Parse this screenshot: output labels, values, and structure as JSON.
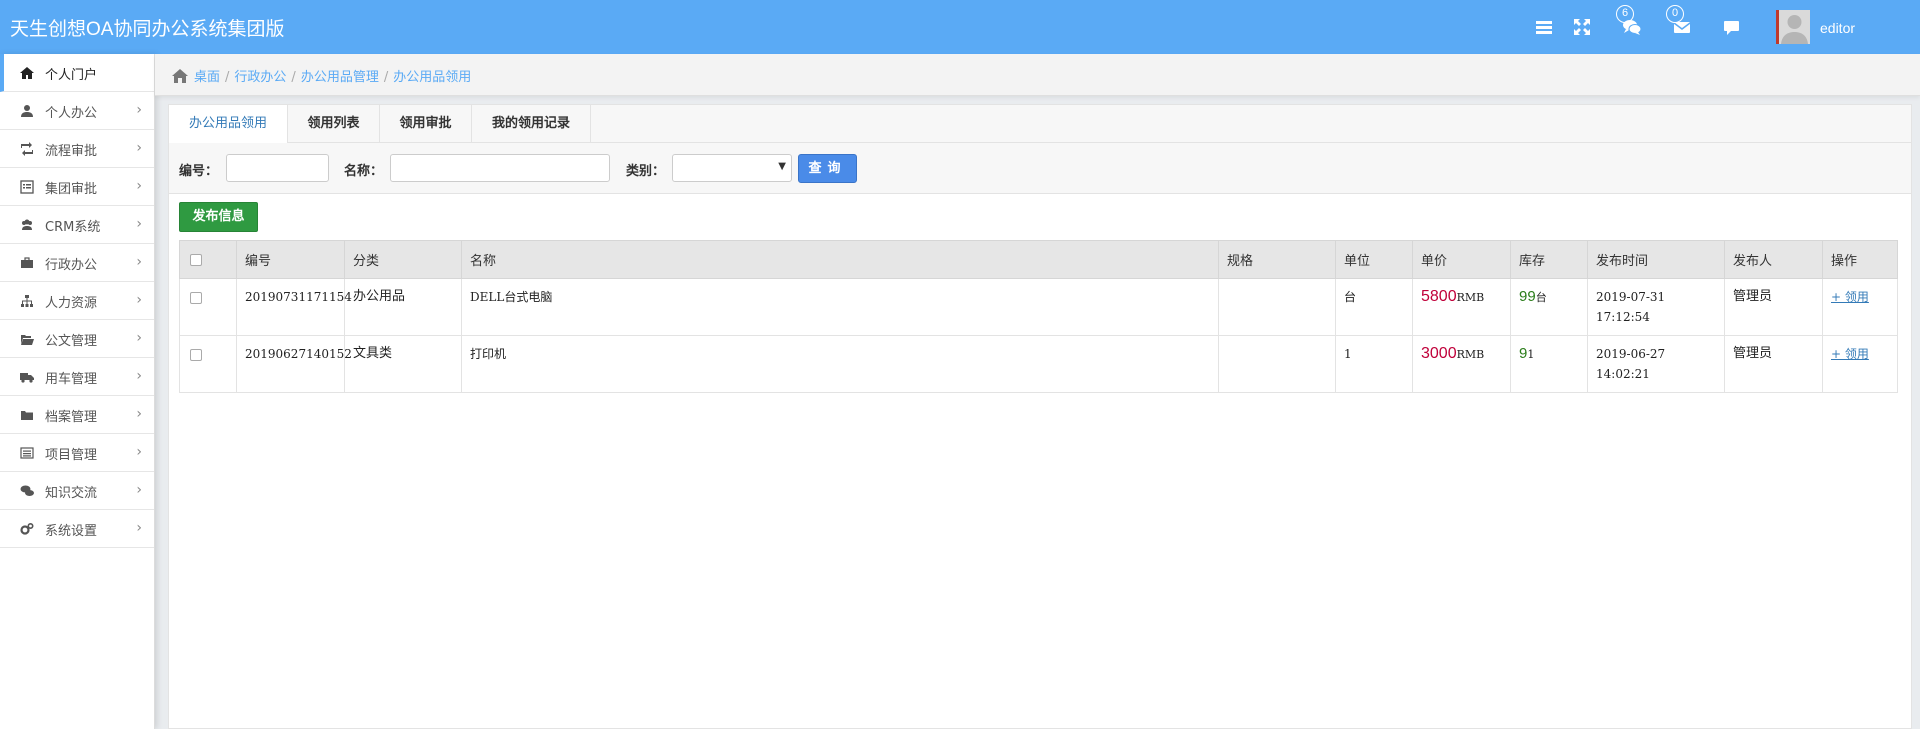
{
  "app": {
    "title": "天生创想OA协同办公系统集团版"
  },
  "header": {
    "chat_badge": "6",
    "mail_badge": "0",
    "username": "editor",
    "icons": [
      "menu-icon",
      "fullscreen-icon",
      "chat-icon",
      "mail-icon",
      "message-icon"
    ]
  },
  "sidebar": {
    "items": [
      {
        "label": "个人门户",
        "icon": "home-icon",
        "active": true
      },
      {
        "label": "个人办公",
        "icon": "user-icon"
      },
      {
        "label": "流程审批",
        "icon": "retweet-icon"
      },
      {
        "label": "集团审批",
        "icon": "list-alt-icon"
      },
      {
        "label": "CRM系统",
        "icon": "users-icon"
      },
      {
        "label": "行政办公",
        "icon": "briefcase-icon"
      },
      {
        "label": "人力资源",
        "icon": "sitemap-icon"
      },
      {
        "label": "公文管理",
        "icon": "folder-open-icon"
      },
      {
        "label": "用车管理",
        "icon": "truck-icon"
      },
      {
        "label": "档案管理",
        "icon": "folder-icon"
      },
      {
        "label": "项目管理",
        "icon": "list-icon"
      },
      {
        "label": "知识交流",
        "icon": "comments-icon"
      },
      {
        "label": "系统设置",
        "icon": "cogs-icon"
      }
    ],
    "arrow": "›"
  },
  "breadcrumb": {
    "items": [
      "桌面",
      "行政办公",
      "办公用品管理",
      "办公用品领用"
    ],
    "separator": "/"
  },
  "tabs": [
    "办公用品领用",
    "领用列表",
    "领用审批",
    "我的领用记录"
  ],
  "filters": {
    "code_label": "编号：",
    "code_value": "",
    "name_label": "名称：",
    "name_value": "",
    "category_label": "类别：",
    "category_value": "",
    "query_label": "查询"
  },
  "publish_label": "发布信息",
  "table": {
    "columns": [
      "",
      "编号",
      "分类",
      "名称",
      "规格",
      "单位",
      "单价",
      "库存",
      "发布时间",
      "发布人",
      "操作"
    ],
    "rows": [
      {
        "code": "20190731171154",
        "category": "办公用品",
        "name": "DELL台式电脑",
        "spec": "",
        "unit": "台",
        "price": "5800",
        "price_unit": "RMB",
        "stock": "99",
        "stock_unit": "台",
        "date": "2019-07-31",
        "time": "17:12:54",
        "publisher": "管理员",
        "action": "+ 领用"
      },
      {
        "code": "20190627140152",
        "category": "文具类",
        "name": "打印机",
        "spec": "",
        "unit": "1",
        "price": "3000",
        "price_unit": "RMB",
        "stock": "9",
        "stock_unit": "1",
        "date": "2019-06-27",
        "time": "14:02:21",
        "publisher": "管理员",
        "action": "+ 领用"
      }
    ]
  },
  "colors": {
    "header": "#5aaaf5",
    "link": "#337ab7",
    "price": "#c0003a",
    "stock": "#2a7d1a",
    "publish_button": "#2f9a41",
    "query_button": "#4a8be8"
  }
}
